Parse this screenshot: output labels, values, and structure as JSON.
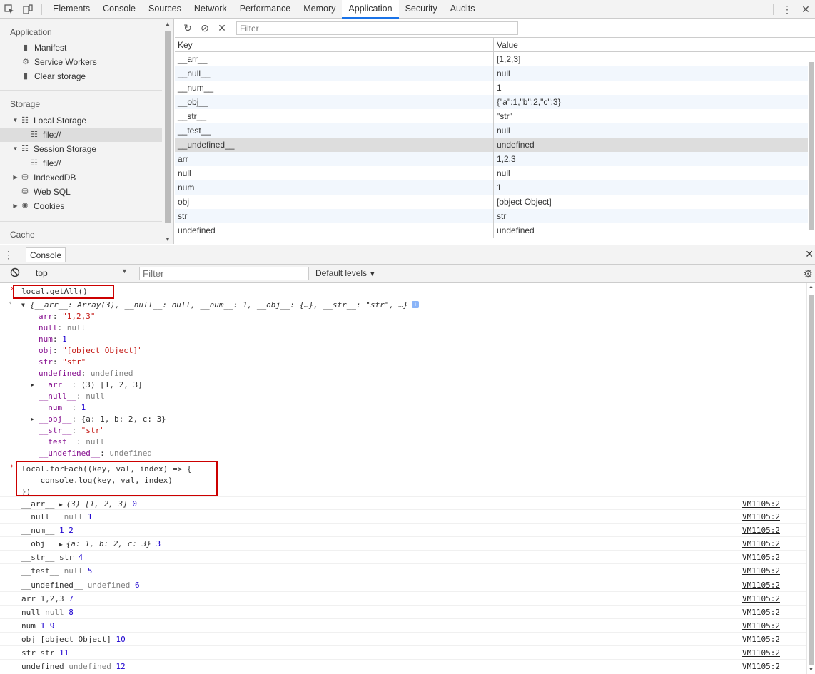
{
  "tabs": [
    "Elements",
    "Console",
    "Sources",
    "Network",
    "Performance",
    "Memory",
    "Application",
    "Security",
    "Audits"
  ],
  "active_tab": "Application",
  "sidebar": {
    "application_title": "Application",
    "app_items": [
      {
        "label": "Manifest",
        "icon": "file-icon"
      },
      {
        "label": "Service Workers",
        "icon": "gear-icon"
      },
      {
        "label": "Clear storage",
        "icon": "trash-icon"
      }
    ],
    "storage_title": "Storage",
    "storage_items": [
      {
        "label": "Local Storage",
        "icon": "grid-icon",
        "expanded": true
      },
      {
        "label": "file://",
        "icon": "grid-icon",
        "child": true,
        "selected": true
      },
      {
        "label": "Session Storage",
        "icon": "grid-icon",
        "expanded": true
      },
      {
        "label": "file://",
        "icon": "grid-icon",
        "child": true
      },
      {
        "label": "IndexedDB",
        "icon": "database-icon",
        "collapsed": true
      },
      {
        "label": "Web SQL",
        "icon": "database-icon"
      },
      {
        "label": "Cookies",
        "icon": "cookie-icon",
        "collapsed": true
      }
    ],
    "cache_title": "Cache"
  },
  "storage": {
    "filter_placeholder": "Filter",
    "columns": {
      "key": "Key",
      "value": "Value"
    },
    "rows": [
      {
        "key": "__arr__",
        "value": "[1,2,3]"
      },
      {
        "key": "__null__",
        "value": "null"
      },
      {
        "key": "__num__",
        "value": "1"
      },
      {
        "key": "__obj__",
        "value": "{\"a\":1,\"b\":2,\"c\":3}"
      },
      {
        "key": "__str__",
        "value": "\"str\""
      },
      {
        "key": "__test__",
        "value": "null"
      },
      {
        "key": "__undefined__",
        "value": "undefined",
        "selected": true
      },
      {
        "key": "arr",
        "value": "1,2,3"
      },
      {
        "key": "null",
        "value": "null"
      },
      {
        "key": "num",
        "value": "1"
      },
      {
        "key": "obj",
        "value": "[object Object]"
      },
      {
        "key": "str",
        "value": "str"
      },
      {
        "key": "undefined",
        "value": "undefined"
      }
    ]
  },
  "drawer": {
    "tab": "Console"
  },
  "console_toolbar": {
    "context": "top",
    "filter_placeholder": "Filter",
    "levels": "Default levels"
  },
  "console": {
    "cmd1": "local.getAll()",
    "result_summary": "{__arr__: Array(3), __null__: null, __num__: 1, __obj__: {…}, __str__: \"str\", …}",
    "props": [
      {
        "k": "arr",
        "v": "\"1,2,3\"",
        "t": "s"
      },
      {
        "k": "null",
        "v": "null",
        "t": "nul"
      },
      {
        "k": "num",
        "v": "1",
        "t": "n"
      },
      {
        "k": "obj",
        "v": "\"[object Object]\"",
        "t": "s"
      },
      {
        "k": "str",
        "v": "\"str\"",
        "t": "s"
      },
      {
        "k": "undefined",
        "v": "undefined",
        "t": "nul"
      },
      {
        "k": "__arr__",
        "v": "(3) [1, 2, 3]",
        "t": "plain",
        "expand": true
      },
      {
        "k": "__null__",
        "v": "null",
        "t": "nul"
      },
      {
        "k": "__num__",
        "v": "1",
        "t": "n"
      },
      {
        "k": "__obj__",
        "v": "{a: 1, b: 2, c: 3}",
        "t": "plain",
        "expand": true
      },
      {
        "k": "__str__",
        "v": "\"str\"",
        "t": "s"
      },
      {
        "k": "__test__",
        "v": "null",
        "t": "nul"
      },
      {
        "k": "__undefined__",
        "v": "undefined",
        "t": "nul"
      }
    ],
    "cmd2_lines": [
      "local.forEach((key, val, index) => {",
      "    console.log(key, val, index)",
      "})"
    ],
    "logs": [
      {
        "key": "__arr__",
        "val": "(3) [1, 2, 3]",
        "idx": "0",
        "obj": true
      },
      {
        "key": "__null__",
        "val": "null",
        "idx": "1"
      },
      {
        "key": "__num__",
        "val": "1",
        "idx": "2",
        "num": true
      },
      {
        "key": "__obj__",
        "val": "{a: 1, b: 2, c: 3}",
        "idx": "3",
        "obj": true
      },
      {
        "key": "__str__",
        "val": "str",
        "idx": "4",
        "plain": true
      },
      {
        "key": "__test__",
        "val": "null",
        "idx": "5"
      },
      {
        "key": "__undefined__",
        "val": "undefined",
        "idx": "6"
      },
      {
        "key": "arr",
        "val": "1,2,3",
        "idx": "7",
        "plain": true
      },
      {
        "key": "null",
        "val": "null",
        "idx": "8"
      },
      {
        "key": "num",
        "val": "1",
        "idx": "9",
        "num": true
      },
      {
        "key": "obj",
        "val": "[object Object]",
        "idx": "10",
        "plain": true
      },
      {
        "key": "str",
        "val": "str",
        "idx": "11",
        "plain": true
      },
      {
        "key": "undefined",
        "val": "undefined",
        "idx": "12"
      }
    ],
    "source": "VM1105:2"
  }
}
